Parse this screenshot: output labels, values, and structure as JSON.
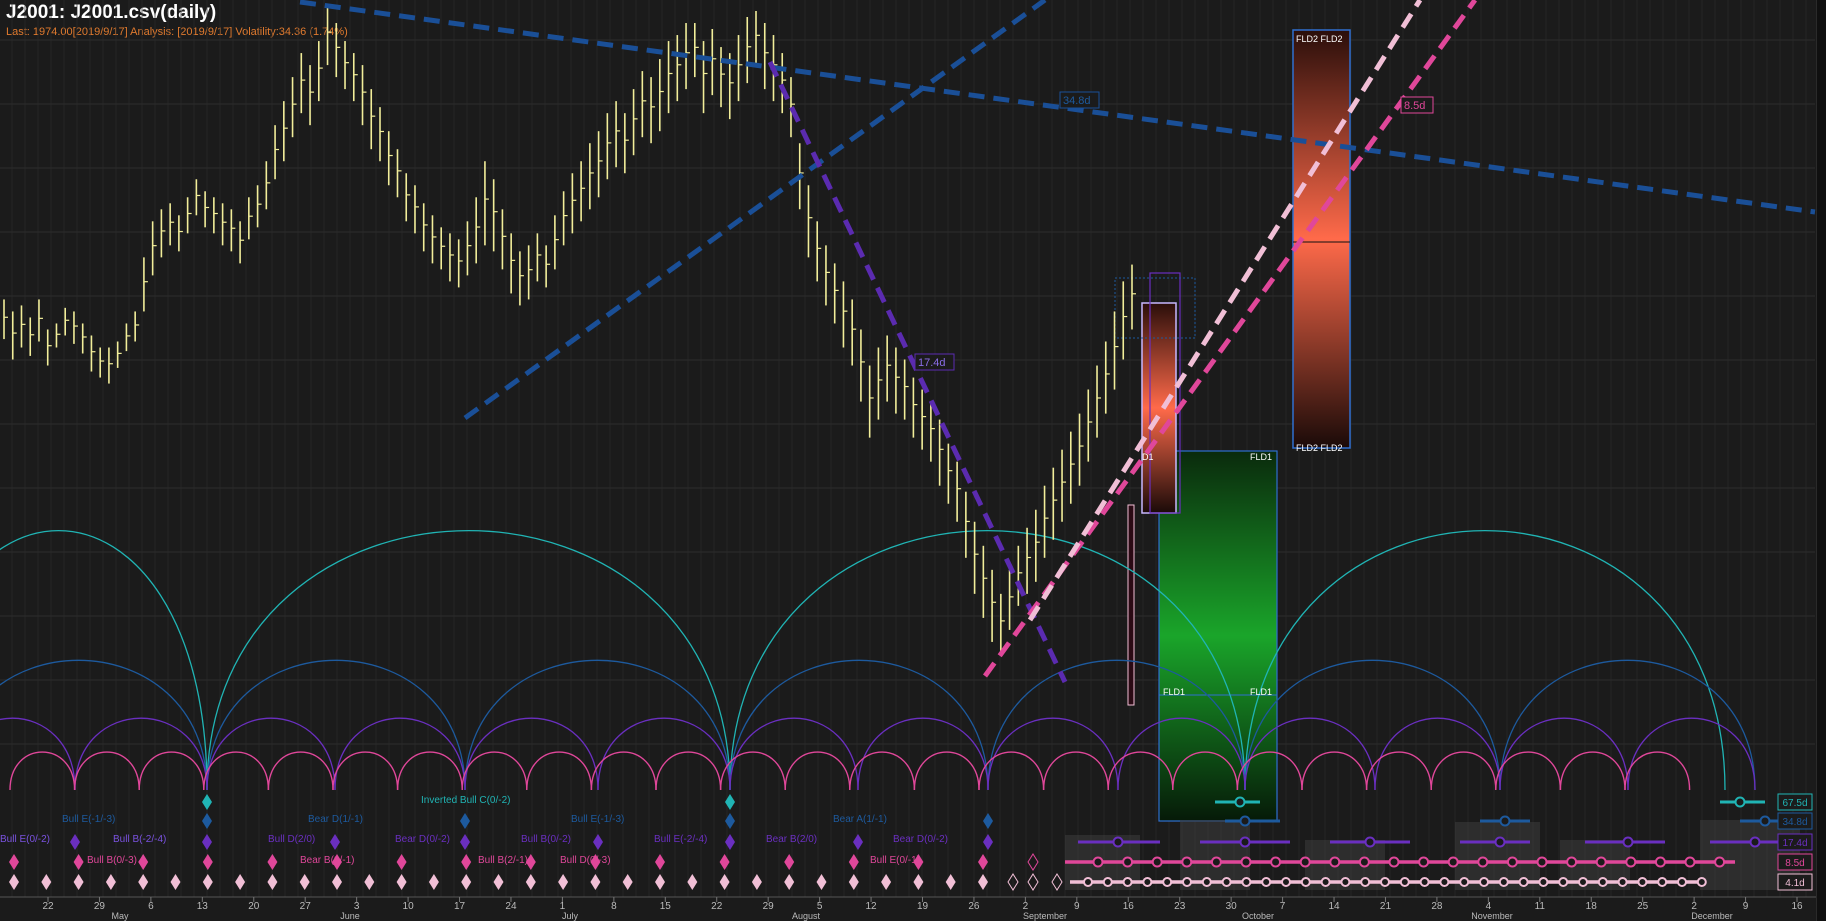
{
  "header": {
    "title": "J2001: J2001.csv(daily)",
    "subtitle": "Last: 1974.00[2019/9/17] Analysis: [2019/9/17] Volatility:34.36 (1.74%)"
  },
  "colors": {
    "background": "#1b1b1b",
    "grid": "#2c2c2c",
    "price_bars": "#f2ee9a",
    "cycle_67_5d": "#20b4b4",
    "cycle_34_8d": "#1d5a9e",
    "cycle_17_4d": "#6a2fc0",
    "cycle_8_5d": "#e0479a",
    "cycle_4_1d": "#f1bfd6",
    "fld2_envelope": "#ff6a4a",
    "fld1_envelope": "#1aa52a"
  },
  "chart_data": {
    "type": "bar",
    "title": "J2001: J2001.csv(daily)",
    "x_axis": {
      "day_ticks": [
        "22",
        "29",
        "6",
        "13",
        "20",
        "27",
        "3",
        "10",
        "17",
        "24",
        "1",
        "8",
        "15",
        "22",
        "29",
        "5",
        "12",
        "19",
        "26",
        "2",
        "9",
        "16",
        "23",
        "30",
        "7",
        "14",
        "21",
        "28",
        "4",
        "11",
        "18",
        "25",
        "2",
        "9",
        "16"
      ],
      "month_labels": [
        "May",
        "June",
        "July",
        "August",
        "September",
        "October",
        "November",
        "December"
      ]
    },
    "y_axis": {
      "labels_visible": false,
      "ylim": [
        1620,
        2190
      ]
    },
    "price_bars": [
      [
        1912,
        1945
      ],
      [
        1895,
        1935
      ],
      [
        1905,
        1940
      ],
      [
        1898,
        1930
      ],
      [
        1910,
        1945
      ],
      [
        1890,
        1920
      ],
      [
        1905,
        1925
      ],
      [
        1915,
        1938
      ],
      [
        1908,
        1935
      ],
      [
        1900,
        1925
      ],
      [
        1885,
        1915
      ],
      [
        1880,
        1905
      ],
      [
        1875,
        1905
      ],
      [
        1888,
        1910
      ],
      [
        1902,
        1925
      ],
      [
        1910,
        1935
      ],
      [
        1935,
        1980
      ],
      [
        1965,
        2010
      ],
      [
        1980,
        2020
      ],
      [
        1990,
        2025
      ],
      [
        1985,
        2015
      ],
      [
        2000,
        2030
      ],
      [
        2015,
        2045
      ],
      [
        2005,
        2035
      ],
      [
        2000,
        2030
      ],
      [
        1990,
        2025
      ],
      [
        1985,
        2020
      ],
      [
        1975,
        2010
      ],
      [
        1995,
        2030
      ],
      [
        2005,
        2040
      ],
      [
        2020,
        2060
      ],
      [
        2045,
        2090
      ],
      [
        2060,
        2110
      ],
      [
        2080,
        2130
      ],
      [
        2100,
        2150
      ],
      [
        2090,
        2140
      ],
      [
        2110,
        2160
      ],
      [
        2140,
        2190
      ],
      [
        2130,
        2175
      ],
      [
        2120,
        2160
      ],
      [
        2110,
        2150
      ],
      [
        2090,
        2140
      ],
      [
        2070,
        2120
      ],
      [
        2060,
        2105
      ],
      [
        2040,
        2085
      ],
      [
        2030,
        2070
      ],
      [
        2010,
        2050
      ],
      [
        2000,
        2040
      ],
      [
        1985,
        2025
      ],
      [
        1975,
        2015
      ],
      [
        1970,
        2005
      ],
      [
        1960,
        2000
      ],
      [
        1955,
        1995
      ],
      [
        1965,
        2010
      ],
      [
        1975,
        2030
      ],
      [
        1990,
        2060
      ],
      [
        1985,
        2045
      ],
      [
        1970,
        2020
      ],
      [
        1950,
        2000
      ],
      [
        1940,
        1985
      ],
      [
        1945,
        1990
      ],
      [
        1960,
        2000
      ],
      [
        1955,
        1990
      ],
      [
        1970,
        2015
      ],
      [
        1990,
        2035
      ],
      [
        2000,
        2050
      ],
      [
        2010,
        2060
      ],
      [
        2020,
        2075
      ],
      [
        2030,
        2085
      ],
      [
        2045,
        2100
      ],
      [
        2055,
        2110
      ],
      [
        2050,
        2100
      ],
      [
        2065,
        2120
      ],
      [
        2080,
        2135
      ],
      [
        2075,
        2130
      ],
      [
        2085,
        2145
      ],
      [
        2100,
        2160
      ],
      [
        2110,
        2165
      ],
      [
        2120,
        2175
      ],
      [
        2130,
        2175
      ],
      [
        2100,
        2160
      ],
      [
        2115,
        2170
      ],
      [
        2105,
        2155
      ],
      [
        2095,
        2150
      ],
      [
        2110,
        2165
      ],
      [
        2125,
        2180
      ],
      [
        2140,
        2185
      ],
      [
        2120,
        2175
      ],
      [
        2110,
        2165
      ],
      [
        2100,
        2150
      ],
      [
        2080,
        2130
      ],
      [
        2020,
        2075
      ],
      [
        1980,
        2040
      ],
      [
        1960,
        2010
      ],
      [
        1940,
        1990
      ],
      [
        1925,
        1975
      ],
      [
        1905,
        1960
      ],
      [
        1890,
        1945
      ],
      [
        1860,
        1920
      ],
      [
        1830,
        1890
      ],
      [
        1845,
        1905
      ],
      [
        1860,
        1915
      ],
      [
        1850,
        1905
      ],
      [
        1845,
        1895
      ],
      [
        1830,
        1880
      ],
      [
        1820,
        1870
      ],
      [
        1810,
        1860
      ],
      [
        1790,
        1845
      ],
      [
        1775,
        1825
      ],
      [
        1760,
        1810
      ],
      [
        1730,
        1785
      ],
      [
        1700,
        1760
      ],
      [
        1680,
        1740
      ],
      [
        1660,
        1720
      ],
      [
        1650,
        1700
      ],
      [
        1670,
        1720
      ],
      [
        1690,
        1740
      ],
      [
        1700,
        1755
      ],
      [
        1710,
        1770
      ],
      [
        1730,
        1790
      ],
      [
        1745,
        1805
      ],
      [
        1760,
        1820
      ],
      [
        1775,
        1835
      ],
      [
        1790,
        1850
      ],
      [
        1810,
        1870
      ],
      [
        1830,
        1890
      ],
      [
        1850,
        1910
      ],
      [
        1870,
        1935
      ],
      [
        1895,
        1960
      ],
      [
        1920,
        1974
      ]
    ],
    "cycles": [
      {
        "name": "67.5d"
      },
      {
        "name": "34.8d"
      },
      {
        "name": "17.4d"
      },
      {
        "name": "8.5d"
      },
      {
        "name": "4.1d"
      }
    ],
    "trendline_labels": [
      {
        "text": "34.8d"
      },
      {
        "text": "17.4d"
      },
      {
        "text": "8.5d"
      }
    ],
    "fld_labels": [
      "FLD2 FLD2",
      "FLD2 FLD2",
      "FLD1",
      "FLD1",
      "FLD1",
      "D1"
    ],
    "signal_labels": [
      {
        "text": "Bull E(0/-2)"
      },
      {
        "text": "Bull B(-2/-4)"
      },
      {
        "text": "Bull B(0/-3)"
      },
      {
        "text": "Bull E(-1/-3)"
      },
      {
        "text": "Bull D(2/0)"
      },
      {
        "text": "Bear D(1/-1)"
      },
      {
        "text": "Bear D(0/-2)"
      },
      {
        "text": "Bear B(0/-1)"
      },
      {
        "text": "Inverted Bull C(0/-2)"
      },
      {
        "text": "Bull B(0/-2)"
      },
      {
        "text": "Bull B(2/-1)"
      },
      {
        "text": "Bull D(0/-3)"
      },
      {
        "text": "Bull E(-1/-3)"
      },
      {
        "text": "Bull E(-2/-4)"
      },
      {
        "text": "Bear B(2/0)"
      },
      {
        "text": "Bear A(1/-1)"
      },
      {
        "text": "Bear D(0/-2)"
      },
      {
        "text": "Bull E(0/-1)"
      }
    ]
  }
}
